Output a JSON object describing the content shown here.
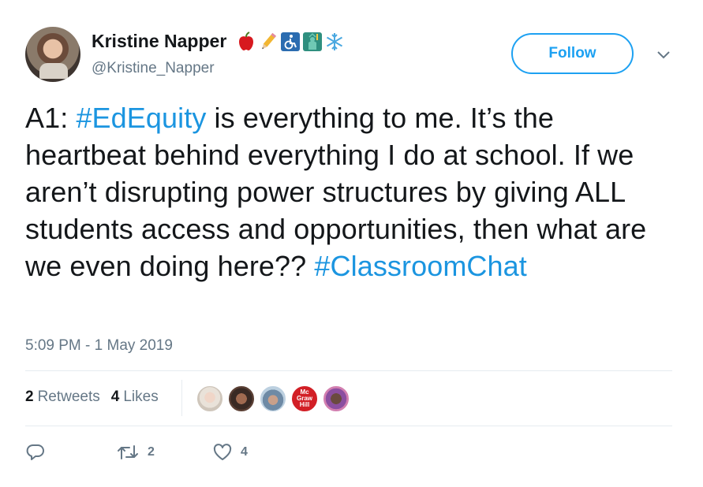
{
  "user": {
    "name": "Kristine Napper",
    "handle": "@Kristine_Napper",
    "name_emojis": [
      "apple-emoji",
      "pencil-emoji",
      "wheelchair-emoji",
      "statue-of-liberty-emoji",
      "snowflake-emoji"
    ]
  },
  "follow_button": {
    "label": "Follow"
  },
  "tweet": {
    "segments": [
      {
        "text": "A1: ",
        "hashtag": false
      },
      {
        "text": "#EdEquity",
        "hashtag": true
      },
      {
        "text": " is everything to me. It’s the heartbeat behind everything I do at school. If we aren’t disrupting power structures by giving ALL students access and opportunities, then what are we even doing here?? ",
        "hashtag": false
      },
      {
        "text": "#ClassroomChat",
        "hashtag": true
      }
    ],
    "timestamp": "5:09 PM - 1 May 2019"
  },
  "stats": {
    "retweets_count": "2",
    "retweets_label": "Retweets",
    "likes_count": "4",
    "likes_label": "Likes"
  },
  "likers": {
    "logo_text": "Mc Graw Hill"
  },
  "actions": {
    "retweet_count": "2",
    "like_count": "4"
  },
  "colors": {
    "accent": "#1da1f2",
    "hashtag": "#1b95e0",
    "secondary_text": "#657786",
    "divider": "#e6ecf0"
  }
}
